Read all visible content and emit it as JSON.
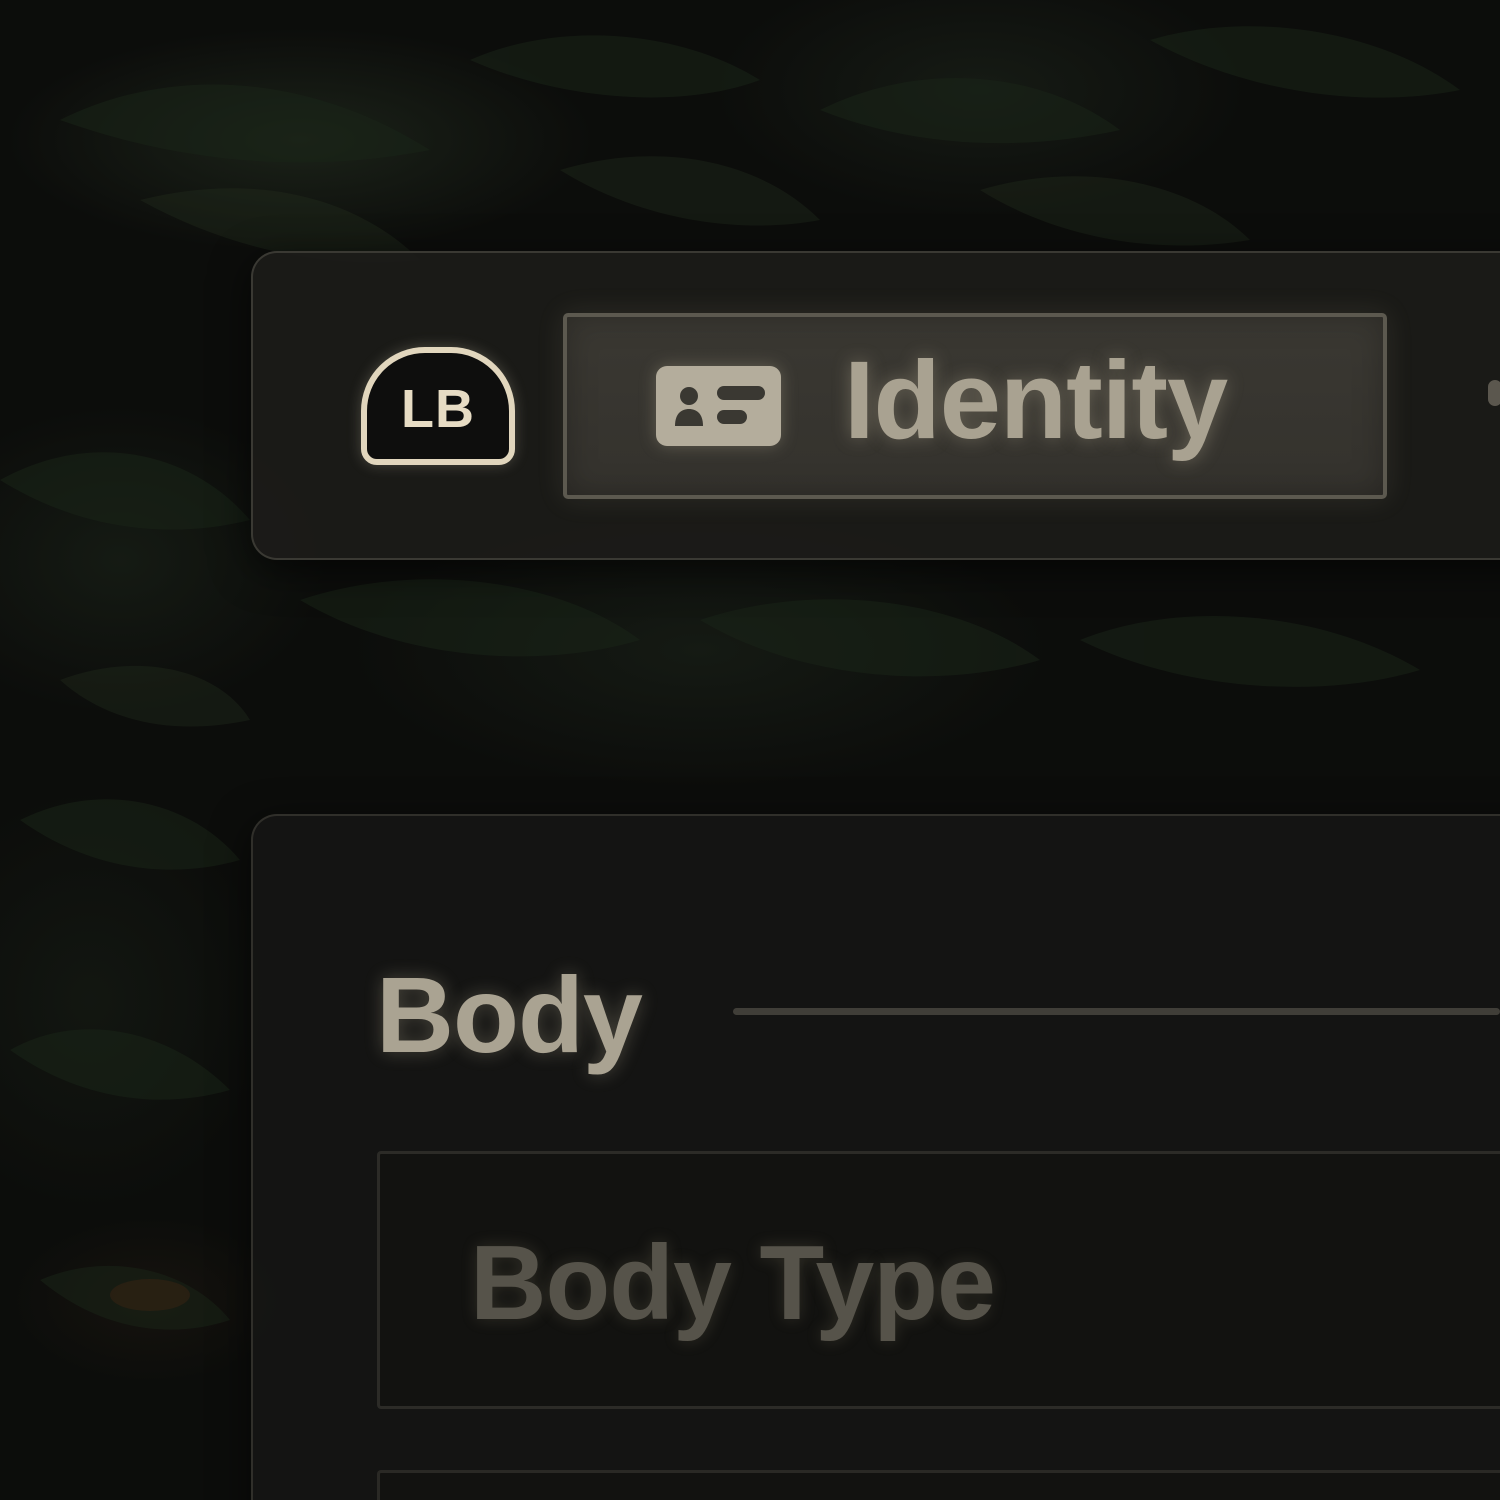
{
  "header": {
    "bumper_button": "LB",
    "active_tab": {
      "label": "Identity",
      "icon": "id-card-icon"
    }
  },
  "sections": [
    {
      "title": "Body",
      "fields": [
        {
          "label": "Body Type"
        }
      ]
    }
  ],
  "colors": {
    "accent": "#e1d6bd",
    "tab_text": "#a9a291",
    "dim_text": "#56534a",
    "panel": "#1c1b19"
  }
}
